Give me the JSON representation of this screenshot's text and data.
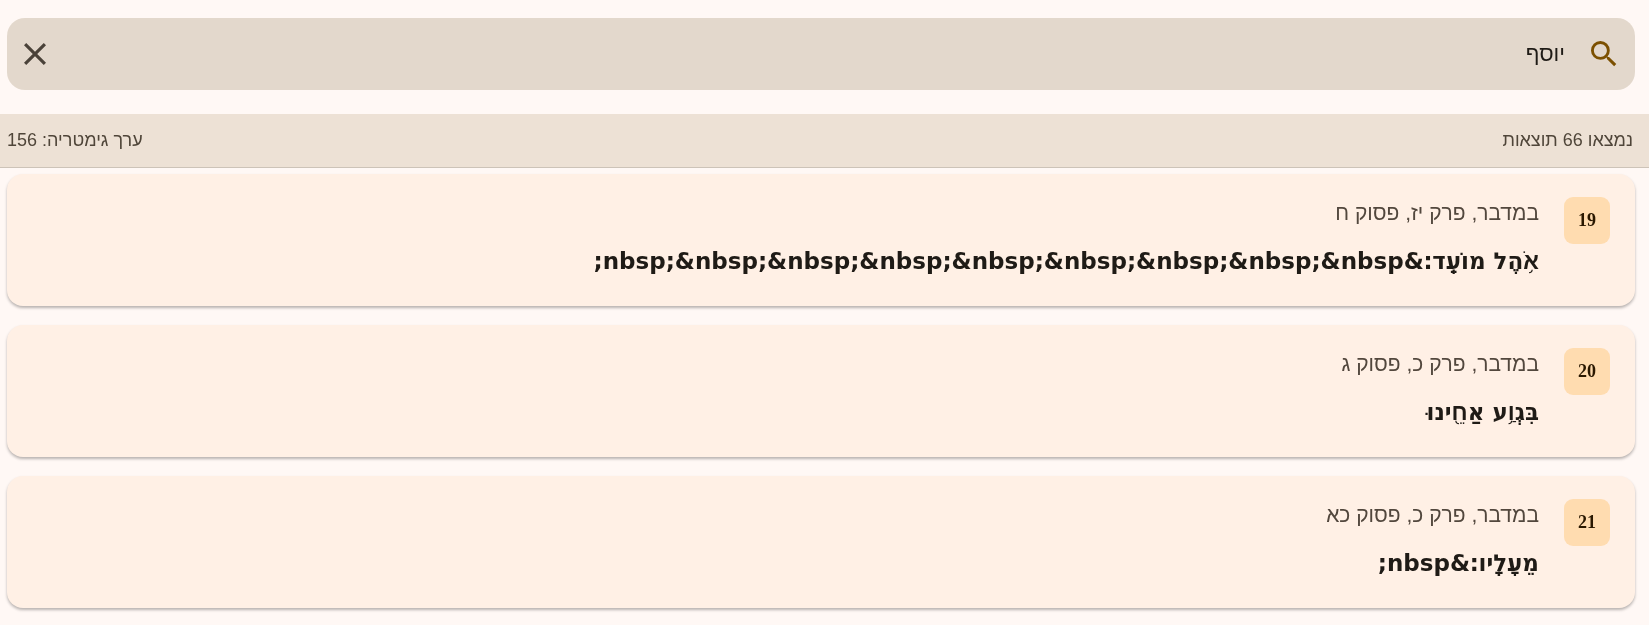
{
  "search": {
    "value": "יוסף"
  },
  "summary": {
    "count_text": "נמצאו 66 תוצאות",
    "gematria_text": "ערך גימטריה: 156"
  },
  "results": [
    {
      "number": "19",
      "reference": "במדבר, פרק יז, פסוק ח",
      "verse": "אֹ֥הֶל מוֹעֵֽד׃&nbsp;&nbsp;&nbsp;&nbsp;&nbsp;&nbsp;&nbsp;&nbsp;&nbsp;"
    },
    {
      "number": "20",
      "reference": "במדבר, פרק כ, פסוק ג",
      "verse": "בִּגְוַ֥ע אַחֵ֖ינוּ"
    },
    {
      "number": "21",
      "reference": "במדבר, פרק כ, פסוק כא",
      "verse": "מֵעָלָֽיו׃&nbsp;"
    }
  ]
}
